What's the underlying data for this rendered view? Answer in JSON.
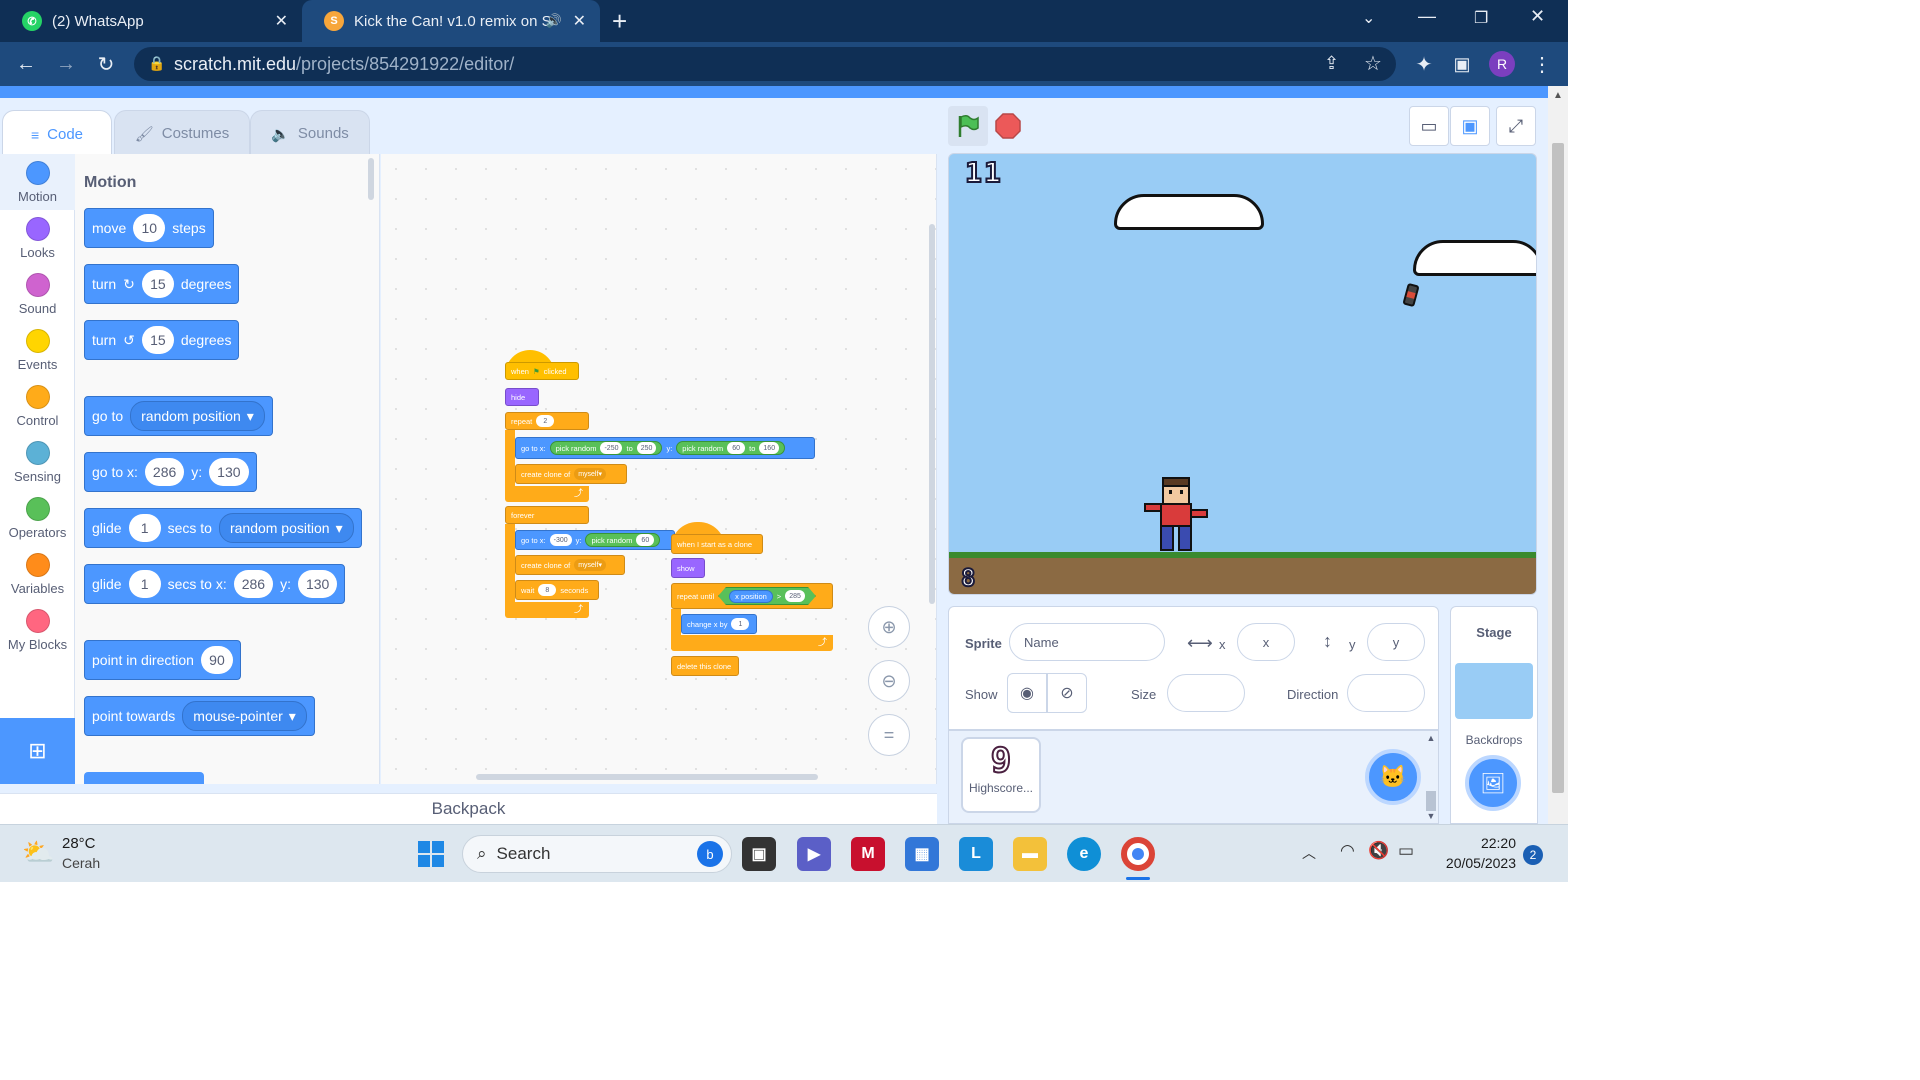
{
  "browser": {
    "tabs": [
      {
        "title": "(2) WhatsApp",
        "close": "✕"
      },
      {
        "title": "Kick the Can! v1.0 remix on S",
        "close": "✕"
      }
    ],
    "new_tab": "+",
    "url_domain": "scratch.mit.edu",
    "url_path": "/projects/854291922/editor/",
    "profile_initial": "R"
  },
  "editor_tabs": {
    "code": "Code",
    "costumes": "Costumes",
    "sounds": "Sounds"
  },
  "categories": [
    {
      "label": "Motion",
      "color": "#4c97ff"
    },
    {
      "label": "Looks",
      "color": "#9966ff"
    },
    {
      "label": "Sound",
      "color": "#cf63cf"
    },
    {
      "label": "Events",
      "color": "#ffd500"
    },
    {
      "label": "Control",
      "color": "#ffab19"
    },
    {
      "label": "Sensing",
      "color": "#5cb1d6"
    },
    {
      "label": "Operators",
      "color": "#59c059"
    },
    {
      "label": "Variables",
      "color": "#ff8c1a"
    },
    {
      "label": "My Blocks",
      "color": "#ff6680"
    }
  ],
  "palette": {
    "title": "Motion",
    "move": {
      "a": "move",
      "v": "10",
      "b": "steps"
    },
    "turn_right": {
      "a": "turn",
      "v": "15",
      "b": "degrees"
    },
    "turn_left": {
      "a": "turn",
      "v": "15",
      "b": "degrees"
    },
    "goto": {
      "a": "go to",
      "d": "random position"
    },
    "gotoxy": {
      "a": "go to x:",
      "x": "286",
      "b": "y:",
      "y": "130"
    },
    "glide_to": {
      "a": "glide",
      "v": "1",
      "b": "secs to",
      "d": "random position"
    },
    "glide_xy": {
      "a": "glide",
      "v": "1",
      "b": "secs to x:",
      "x": "286",
      "c": "y:",
      "y": "130"
    },
    "point_dir": {
      "a": "point in direction",
      "v": "90"
    },
    "point_towards": {
      "a": "point towards",
      "d": "mouse-pointer"
    }
  },
  "script1": {
    "when": "when",
    "clicked": "clicked",
    "hide": "hide",
    "repeat": "repeat",
    "repeat_n": "2",
    "goto_x": "go to x:",
    "pick1": "pick random",
    "p1a": "-250",
    "to1": "to",
    "p1b": "250",
    "y": "y:",
    "pick2": "pick random",
    "p2a": "60",
    "to2": "to",
    "p2b": "160",
    "create_clone": "create clone of",
    "myself": "myself",
    "forever": "forever",
    "goto_x2": "go to x:",
    "x2": "-300",
    "y2": "y:",
    "pick3": "pick random",
    "p3a": "60",
    "create_clone2": "create clone of",
    "myself2": "myself",
    "wait": "wait",
    "wait_v": "8",
    "seconds": "seconds"
  },
  "script2": {
    "hat": "when I start as a clone",
    "show": "show",
    "repeat_until": "repeat until",
    "xpos": "x position",
    "gt": ">",
    "gt_v": "285",
    "change_x": "change x by",
    "change_v": "1",
    "delete": "delete this clone"
  },
  "backpack": "Backpack",
  "stage": {
    "score": "11",
    "lives": "8"
  },
  "sprite_info": {
    "sprite_label": "Sprite",
    "name_placeholder": "Name",
    "x_label": "x",
    "x_placeholder": "x",
    "y_label": "y",
    "y_placeholder": "y",
    "show_label": "Show",
    "size_label": "Size",
    "direction_label": "Direction"
  },
  "sprite_list": [
    {
      "name": "Highscore...",
      "glyph": "9"
    }
  ],
  "stage_panel": {
    "title": "Stage",
    "backdrops": "Backdrops"
  },
  "taskbar": {
    "temp": "28°C",
    "weather": "Cerah",
    "search": "Search",
    "time": "22:20",
    "date": "20/05/2023",
    "notifications": "2"
  }
}
